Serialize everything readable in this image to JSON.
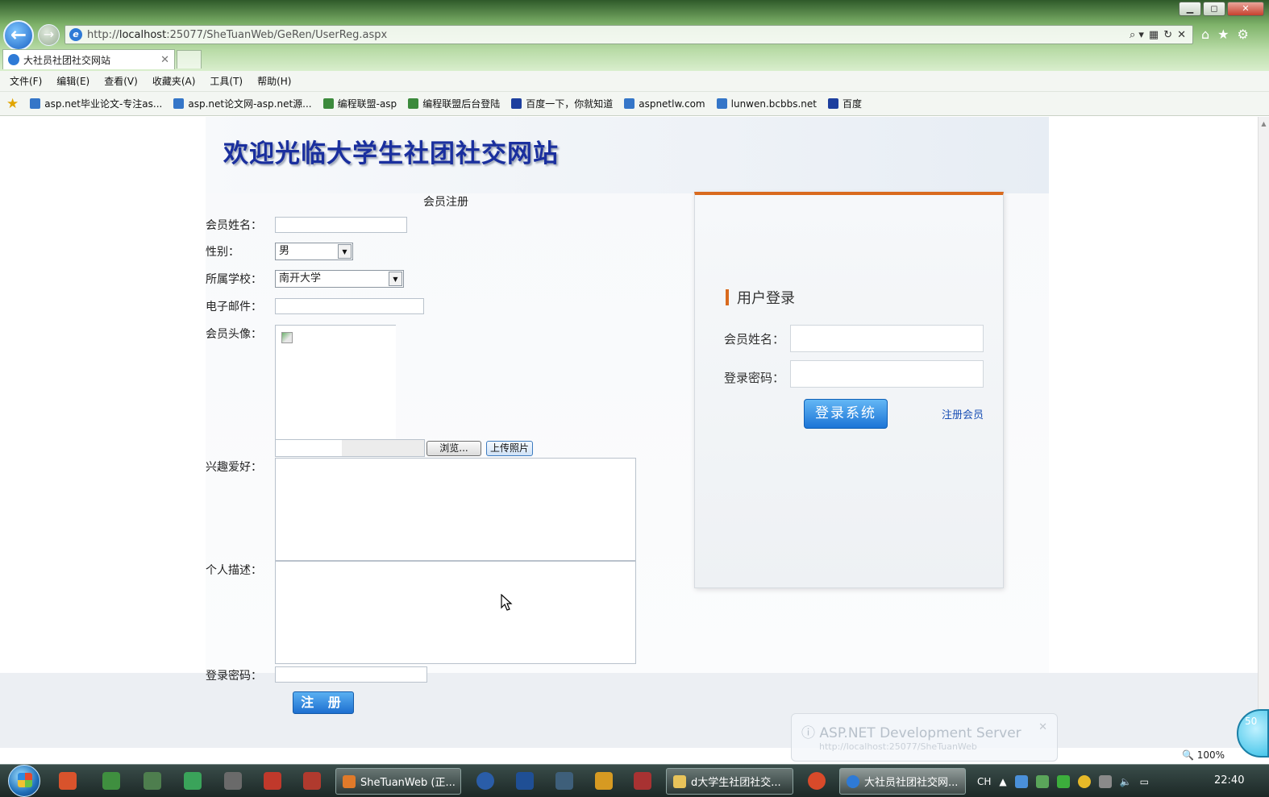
{
  "window": {
    "minimize": "▁",
    "maximize": "◻",
    "close": "✕"
  },
  "browser": {
    "back_glyph": "←",
    "forward_glyph": "→",
    "url_prefix": "http://",
    "url_host": "localhost",
    "url_rest": ":25077/SheTuanWeb/GeRen/UserReg.aspx",
    "addr_actions": [
      "⌕ ▾",
      "▦",
      "↻",
      "✕"
    ],
    "right_tools": [
      "⌂",
      "★",
      "⚙"
    ],
    "tab_title": "大社员社团社交网站",
    "tab_close": "✕"
  },
  "menu": [
    "文件(F)",
    "编辑(E)",
    "查看(V)",
    "收藏夹(A)",
    "工具(T)",
    "帮助(H)"
  ],
  "favorites": [
    {
      "label": "asp.net毕业论文-专注as...",
      "icon": "ie-page-icon"
    },
    {
      "label": "asp.net论文网-asp.net源...",
      "icon": "ie-page-icon"
    },
    {
      "label": "编程联盟-asp",
      "icon": "site-icon"
    },
    {
      "label": "编程联盟后台登陆",
      "icon": "site-icon"
    },
    {
      "label": "百度一下，你就知道",
      "icon": "baidu-paw-icon"
    },
    {
      "label": "aspnetlw.com",
      "icon": "ie-page-icon"
    },
    {
      "label": "lunwen.bcbbs.net",
      "icon": "ie-page-icon"
    },
    {
      "label": "百度",
      "icon": "baidu-paw-icon"
    }
  ],
  "page": {
    "banner_title": "欢迎光临大学生社团社交网站",
    "registration": {
      "title": "会员注册",
      "name_label": "会员姓名：",
      "gender_label": "性别：",
      "gender_value": "男",
      "school_label": "所属学校：",
      "school_value": "南开大学",
      "email_label": "电子邮件：",
      "avatar_label": "会员头像：",
      "browse_button": "浏览...",
      "upload_button": "上传照片",
      "hobbies_label": "兴趣爱好：",
      "description_label": "个人描述：",
      "password_label": "登录密码：",
      "submit_button": "注 册"
    },
    "login": {
      "heading": "用户登录",
      "name_label": "会员姓名：",
      "password_label": "登录密码：",
      "login_button": "登录系统",
      "register_link": "注册会员"
    }
  },
  "notification": {
    "title": "ASP.NET Development Server",
    "url": "http://localhost:25077/SheTuanWeb",
    "close": "✕"
  },
  "status": {
    "zoom": "100%",
    "side_widget": "50"
  },
  "taskbar": {
    "tasks": [
      {
        "label": "SheTuanWeb (正...",
        "active": false
      },
      {
        "label": "d大学生社团社交...",
        "active": false
      },
      {
        "label": "大社员社团社交网...",
        "active": true
      }
    ],
    "tray_lang": "CH",
    "clock": "22:40"
  },
  "colors": {
    "accent_orange": "#d96a1e",
    "button_blue": "#1d6fd0",
    "banner_text": "#1a2f9e"
  }
}
